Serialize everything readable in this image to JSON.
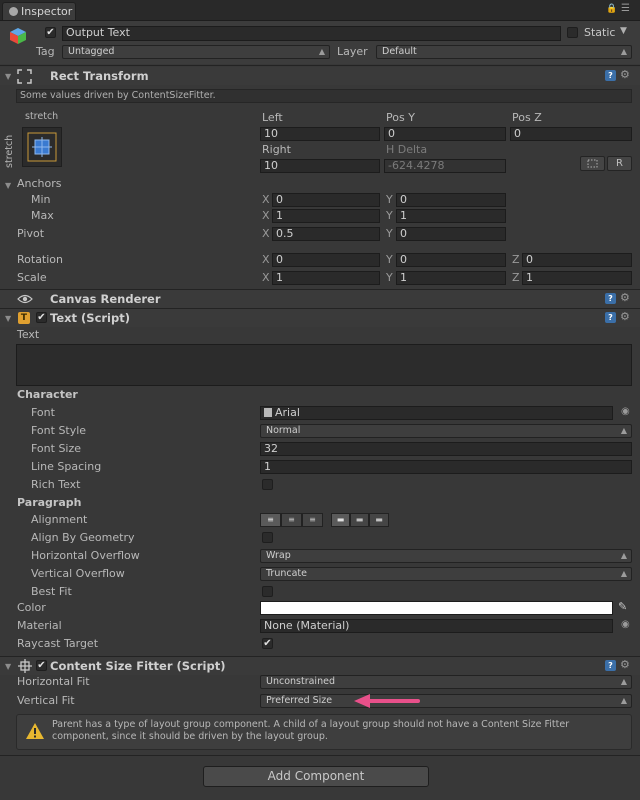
{
  "window": {
    "tab_title": "Inspector"
  },
  "gameobject": {
    "active": true,
    "name": "Output Text",
    "static_label": "Static",
    "static_checked": false,
    "tag_label": "Tag",
    "tag_value": "Untagged",
    "layer_label": "Layer",
    "layer_value": "Default"
  },
  "rect_transform": {
    "title": "Rect Transform",
    "driven_note": "Some values driven by ContentSizeFitter.",
    "anchor_preset_top": "stretch",
    "anchor_preset_side": "stretch",
    "col_left": "Left",
    "col_posy": "Pos Y",
    "col_posz": "Pos Z",
    "left_value": "10",
    "posy_value": "0",
    "posz_value": "0",
    "col_right": "Right",
    "col_hdelta": "H Delta",
    "right_value": "10",
    "hdelta_value": "-624.4278",
    "raw_button": "R",
    "anchors_label": "Anchors",
    "min_label": "Min",
    "min_x": "0",
    "min_y": "0",
    "max_label": "Max",
    "max_x": "1",
    "max_y": "1",
    "pivot_label": "Pivot",
    "pivot_x": "0.5",
    "pivot_y": "0",
    "rotation_label": "Rotation",
    "rot_x": "0",
    "rot_y": "0",
    "rot_z": "0",
    "scale_label": "Scale",
    "scale_x": "1",
    "scale_y": "1",
    "scale_z": "1",
    "axis_x": "X",
    "axis_y": "Y",
    "axis_z": "Z"
  },
  "canvas_renderer": {
    "title": "Canvas Renderer"
  },
  "text_script": {
    "title": "Text (Script)",
    "enabled": true,
    "text_label": "Text",
    "text_value": "",
    "character_header": "Character",
    "font_label": "Font",
    "font_value": "Arial",
    "font_style_label": "Font Style",
    "font_style_value": "Normal",
    "font_size_label": "Font Size",
    "font_size_value": "32",
    "line_spacing_label": "Line Spacing",
    "line_spacing_value": "1",
    "rich_text_label": "Rich Text",
    "rich_text_checked": false,
    "paragraph_header": "Paragraph",
    "alignment_label": "Alignment",
    "align_by_geometry_label": "Align By Geometry",
    "align_by_geometry_checked": false,
    "h_overflow_label": "Horizontal Overflow",
    "h_overflow_value": "Wrap",
    "v_overflow_label": "Vertical Overflow",
    "v_overflow_value": "Truncate",
    "best_fit_label": "Best Fit",
    "best_fit_checked": false,
    "color_label": "Color",
    "color_value": "#ffffff",
    "material_label": "Material",
    "material_value": "None (Material)",
    "raycast_label": "Raycast Target",
    "raycast_checked": true
  },
  "content_size_fitter": {
    "title": "Content Size Fitter (Script)",
    "enabled": true,
    "horizontal_fit_label": "Horizontal Fit",
    "horizontal_fit_value": "Unconstrained",
    "vertical_fit_label": "Vertical Fit",
    "vertical_fit_value": "Preferred Size",
    "warning_line1": "Parent has a type of layout group component. A child of a layout group should not have a Content Size Fitter",
    "warning_line2": "component, since it should be driven by the layout group."
  },
  "add_component": {
    "label": "Add Component"
  },
  "colors": {
    "annotation_arrow": "#e8508a",
    "help_icon": "#3b6fa8",
    "warning_icon": "#e8b830"
  }
}
